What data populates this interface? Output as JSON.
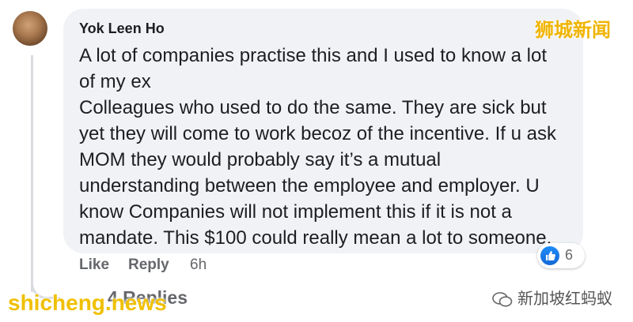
{
  "comment": {
    "author": "Yok Leen Ho",
    "lines": [
      "A lot of companies practise this and I used to know a lot",
      "of my ex",
      "Colleagues who used to do the same. They are sick but",
      "yet they will come to work becoz of the incentive. If u ask",
      "MOM they would probably say it’s a mutual",
      "understanding between the employee and employer. U",
      "know Companies will not implement this if it is not a",
      "mandate. This $100 could really mean a lot to someone."
    ],
    "actions": {
      "like": "Like",
      "reply": "Reply",
      "time": "6h"
    },
    "reactions": {
      "icon": "like-icon",
      "count": "6",
      "color": "#1877f2"
    },
    "replies": "4 Replies"
  },
  "watermarks": {
    "top_right": "狮城新闻",
    "bottom_left": "shicheng.news",
    "bottom_right": "新加坡红蚂蚁"
  },
  "colors": {
    "bubble": "#f0f2f5",
    "text": "#1c1e21",
    "muted": "#65676b",
    "watermark": "#f0b400"
  }
}
